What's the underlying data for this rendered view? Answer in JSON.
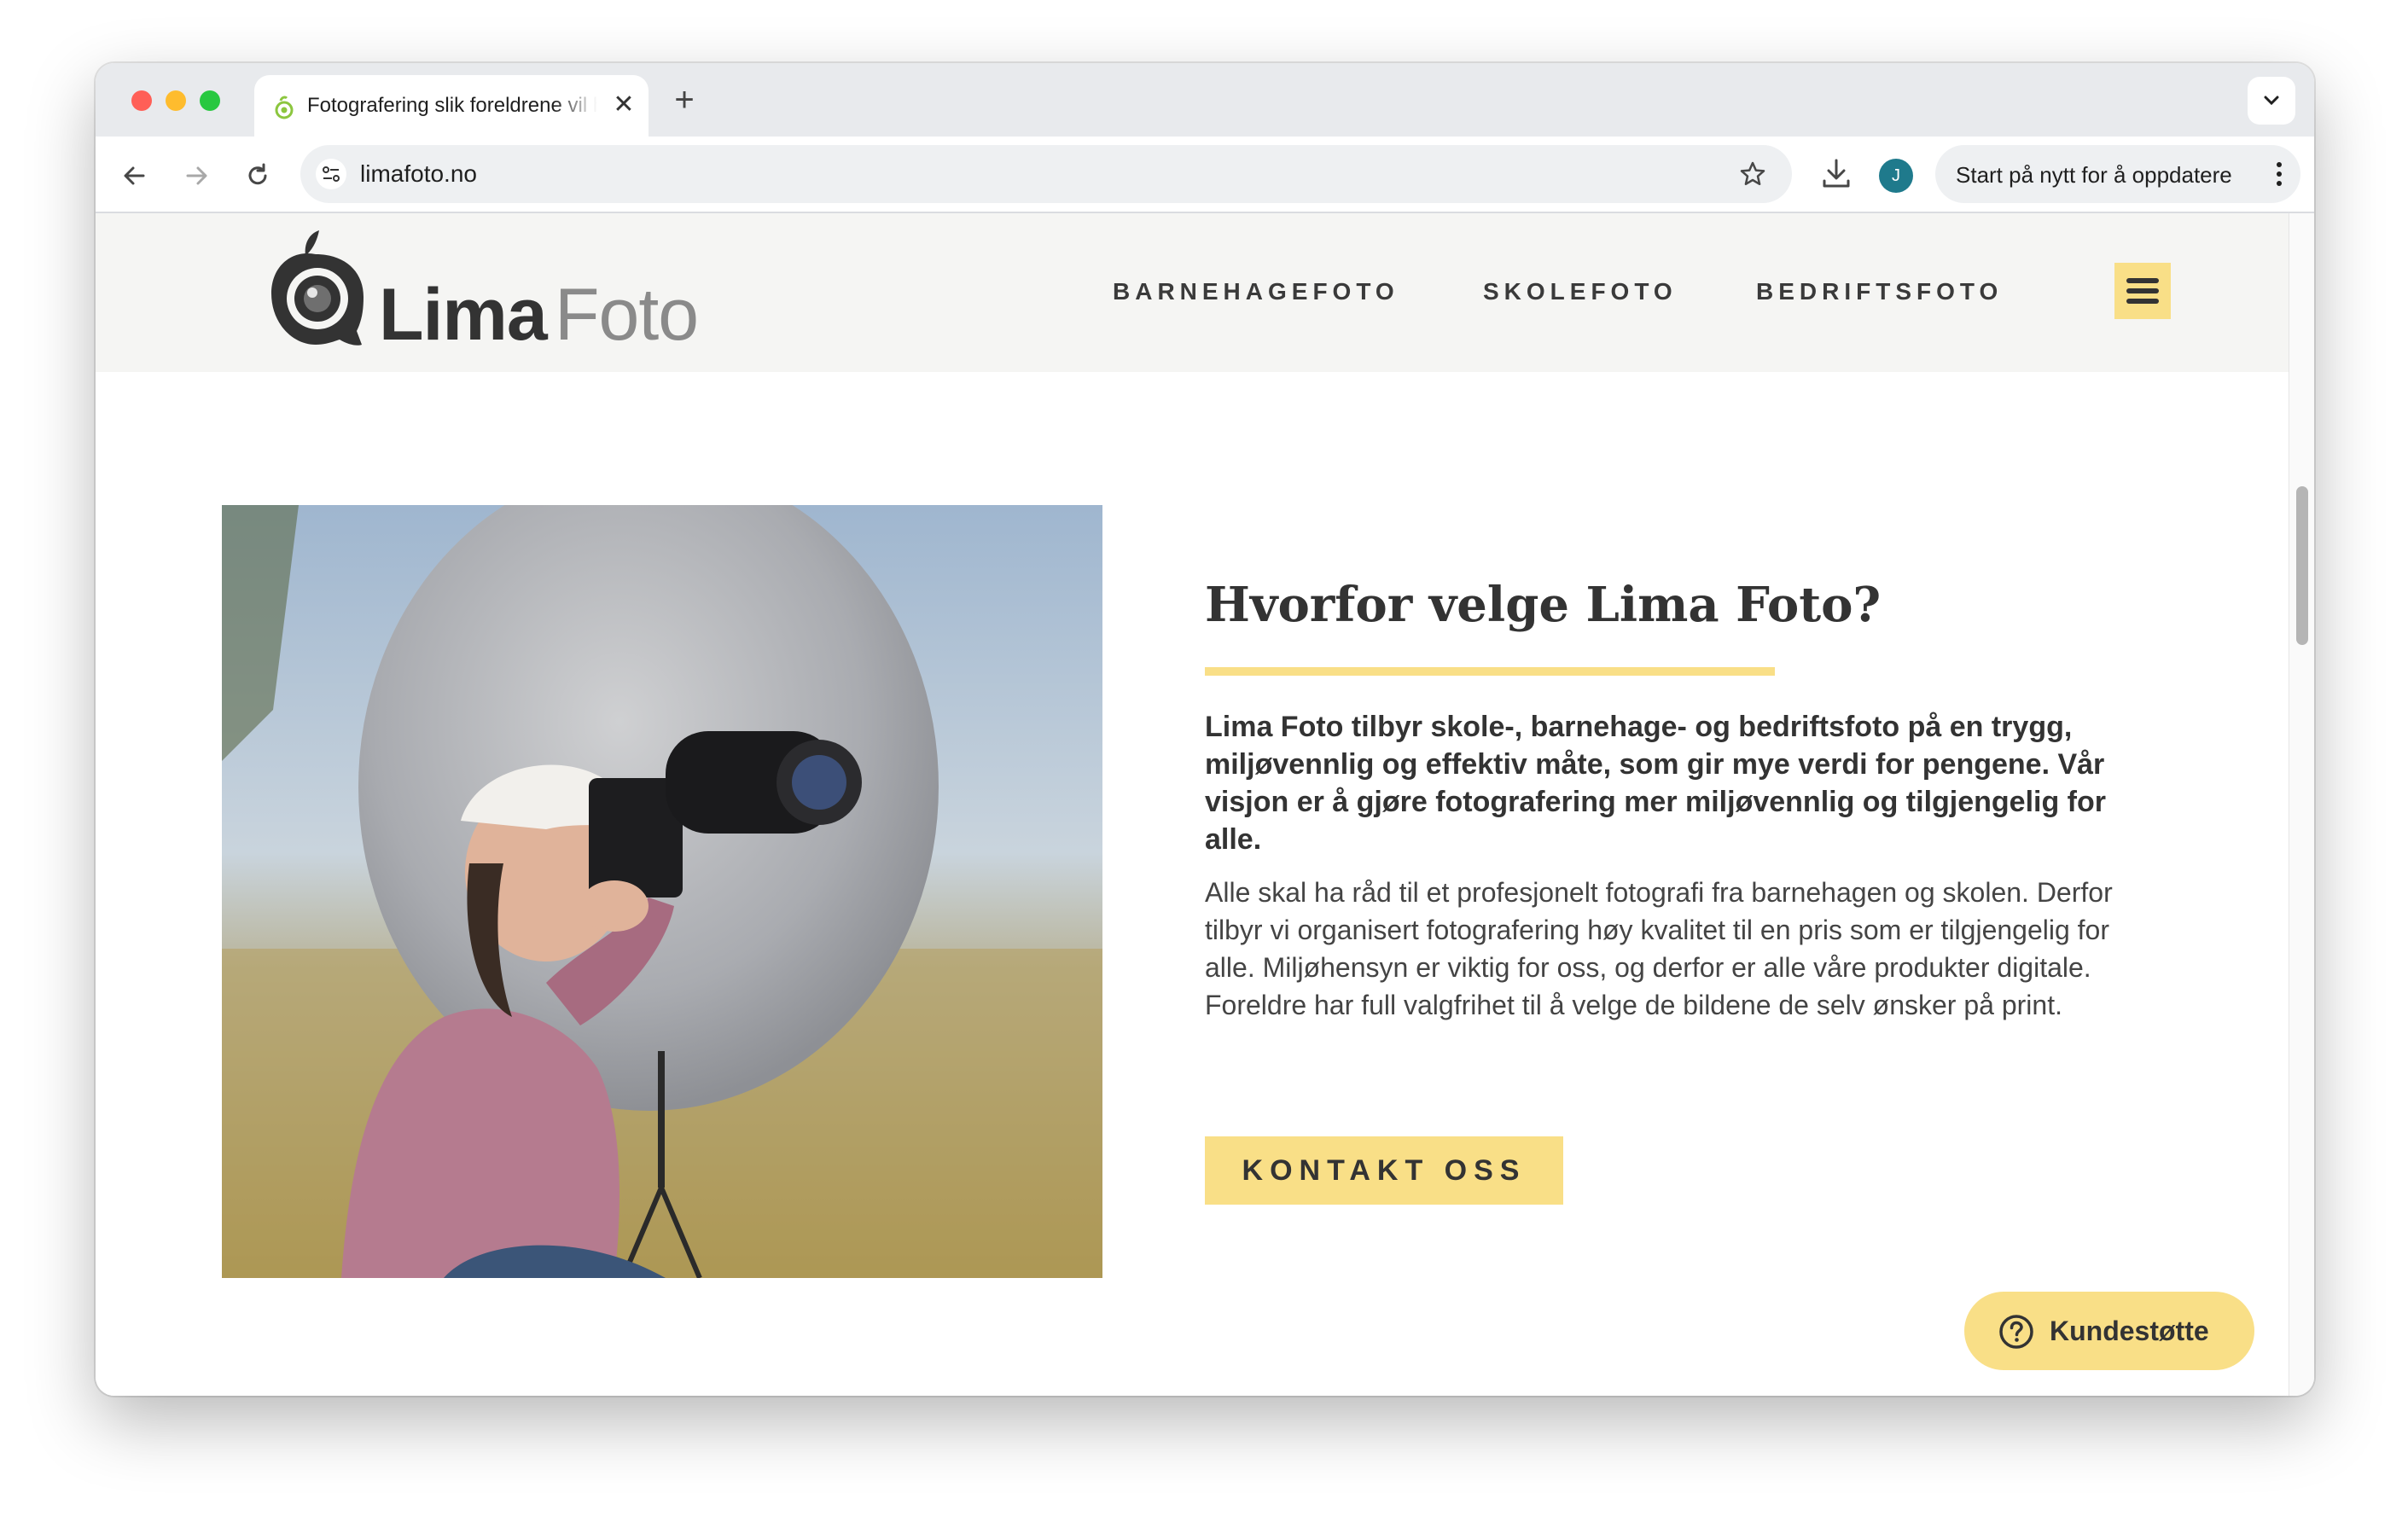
{
  "browser": {
    "tab_title": "Fotografering slik foreldrene vil ha det",
    "new_tab_symbol": "+",
    "close_symbol": "✕",
    "url": "limafoto.no",
    "profile_initial": "J",
    "update_label": "Start på nytt for å oppdatere"
  },
  "site": {
    "logo_primary": "Lima",
    "logo_secondary": "Foto",
    "nav": [
      "BARNEHAGEFOTO",
      "SKOLEFOTO",
      "BEDRIFTSFOTO"
    ]
  },
  "main": {
    "heading": "Hvorfor velge Lima Foto?",
    "lead": "Lima Foto tilbyr skole-, barnehage- og bedriftsfoto på en trygg, miljøvennlig og effektiv måte, som gir mye verdi for pengene. Vår visjon er å gjøre fotografering mer miljøvennlig og tilgjengelig for alle.",
    "body": "Alle skal ha råd til et profesjonelt fotografi fra barnehagen og skolen. Derfor tilbyr vi organisert fotografering høy kvalitet til en pris som er tilgjengelig for alle. Miljøhensyn er viktig for oss, og derfor er alle våre produkter digitale. Foreldre har full valgfrihet til å velge de bildene de selv ønsker på print.",
    "cta_label": "KONTAKT OSS"
  },
  "support": {
    "label": "Kundestøtte"
  },
  "colors": {
    "accent": "#f9df87",
    "text": "#333333",
    "header_bg": "#f5f5f3"
  }
}
